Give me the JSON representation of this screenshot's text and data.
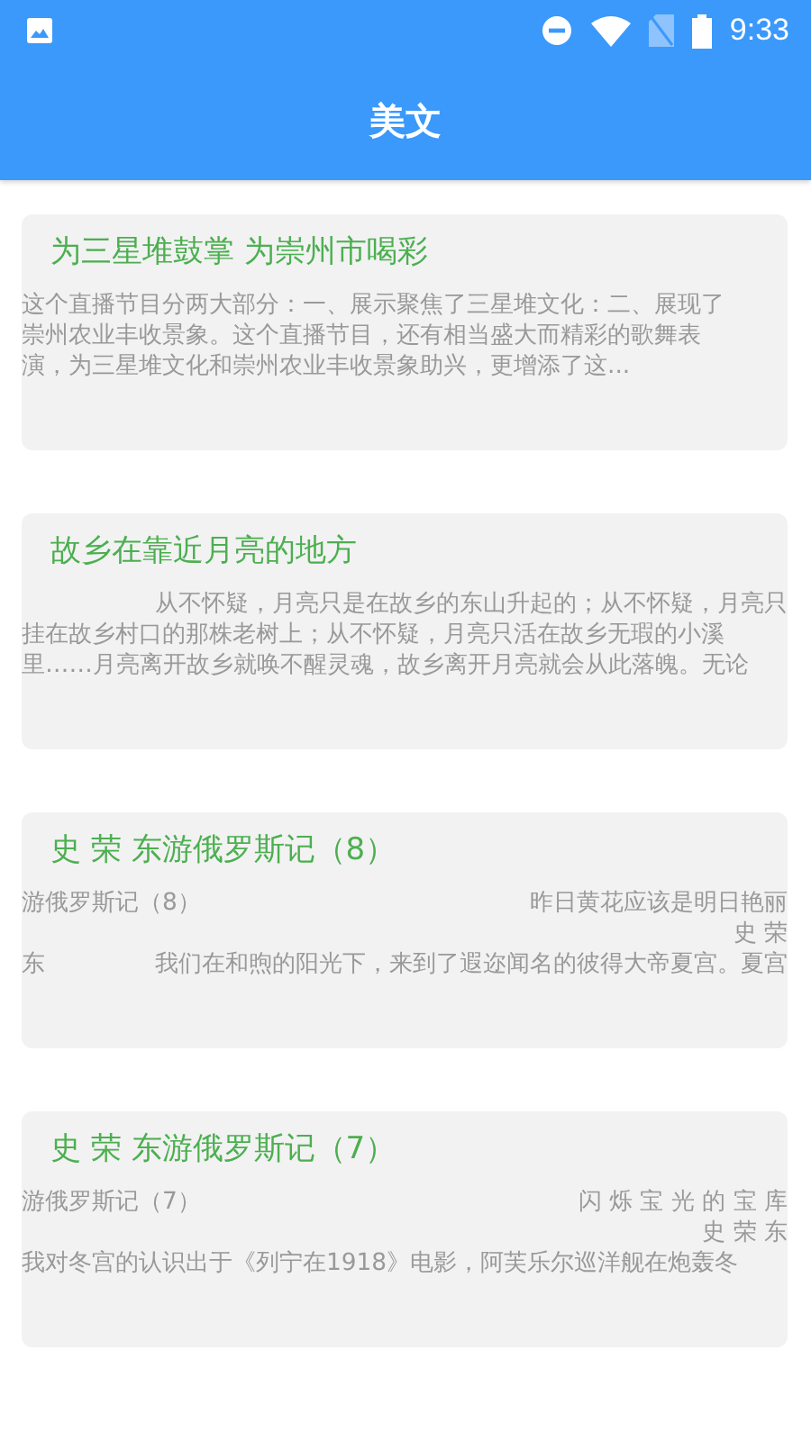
{
  "status_bar": {
    "time": "9:33"
  },
  "app_bar": {
    "title": "美文"
  },
  "articles": [
    {
      "title": "为三星堆鼓掌 为崇州市喝彩",
      "lines": [
        {
          "left": "这个直播节目分两大部分：一、展示聚焦了三星堆文化：二、展现了"
        },
        {
          "left": "崇州农业丰收景象。这个直播节目，还有相当盛大而精彩的歌舞表"
        },
        {
          "left": "演，为三星堆文化和崇州农业丰收景象助兴，更增添了这..."
        }
      ]
    },
    {
      "title": "故乡在靠近月亮的地方",
      "lines": [
        {
          "right": "从不怀疑，月亮只是在故乡的东山升起的；从不怀疑，月亮只"
        },
        {
          "left": "挂在故乡村口的那株老树上；从不怀疑，月亮只活在故乡无瑕的小溪"
        },
        {
          "left": "里……月亮离开故乡就唤不醒灵魂，故乡离开月亮就会从此落魄。无论"
        }
      ]
    },
    {
      "title": "史 荣 东游俄罗斯记（8）",
      "lines": [
        {
          "left": "游俄罗斯记（8）",
          "right": "昨日黄花应该是明日艳丽"
        },
        {
          "right": "史 荣"
        },
        {
          "left": "东",
          "right": "我们在和煦的阳光下，来到了遐迩闻名的彼得大帝夏宫。夏宫"
        }
      ]
    },
    {
      "title": "史 荣 东游俄罗斯记（7）",
      "lines": [
        {
          "left": "游俄罗斯记（7）",
          "right": "闪 烁 宝 光 的 宝 库"
        },
        {
          "right": "史 荣 东"
        },
        {
          "left": "我对冬宫的认识出于《列宁在1918》电影，阿芙乐尔巡洋舰在炮轰冬"
        }
      ]
    }
  ]
}
